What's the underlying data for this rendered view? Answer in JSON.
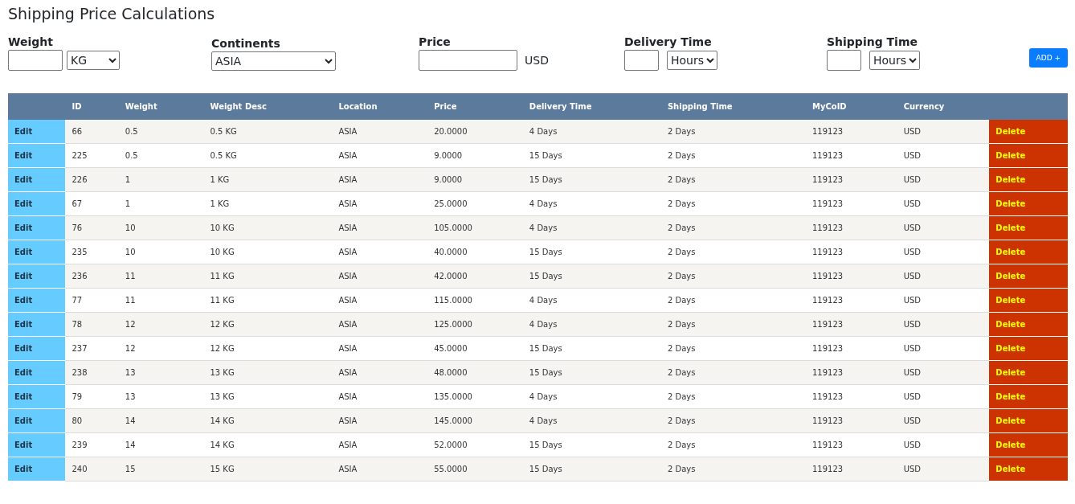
{
  "title": "Shipping Price Calculations",
  "form": {
    "fields": [
      {
        "kind": "weight",
        "label": "Weight",
        "select": "KG"
      },
      {
        "kind": "continent",
        "label": "Continents",
        "select": "ASIA"
      },
      {
        "kind": "price",
        "label": "Price",
        "suffix": "USD"
      },
      {
        "kind": "time",
        "label": "Delivery Time",
        "select": "Hours"
      },
      {
        "kind": "time",
        "label": "Shipping Time",
        "select": "Hours"
      }
    ],
    "add_button": "ADD +"
  },
  "table": {
    "columns": [
      "ID",
      "Weight",
      "Weight Desc",
      "Location",
      "Price",
      "Delivery Time",
      "Shipping Time",
      "MyCoID",
      "Currency"
    ],
    "rows": [
      {
        "edit": "Edit",
        "cells": [
          "66",
          "0.5",
          "0.5 KG",
          "ASIA",
          "20.0000",
          "4 Days",
          "2 Days",
          "119123",
          "USD"
        ],
        "delete": "Delete"
      },
      {
        "edit": "Edit",
        "cells": [
          "225",
          "0.5",
          "0.5 KG",
          "ASIA",
          "9.0000",
          "15 Days",
          "2 Days",
          "119123",
          "USD"
        ],
        "delete": "Delete"
      },
      {
        "edit": "Edit",
        "cells": [
          "226",
          "1",
          "1 KG",
          "ASIA",
          "9.0000",
          "15 Days",
          "2 Days",
          "119123",
          "USD"
        ],
        "delete": "Delete"
      },
      {
        "edit": "Edit",
        "cells": [
          "67",
          "1",
          "1 KG",
          "ASIA",
          "25.0000",
          "4 Days",
          "2 Days",
          "119123",
          "USD"
        ],
        "delete": "Delete"
      },
      {
        "edit": "Edit",
        "cells": [
          "76",
          "10",
          "10 KG",
          "ASIA",
          "105.0000",
          "4 Days",
          "2 Days",
          "119123",
          "USD"
        ],
        "delete": "Delete"
      },
      {
        "edit": "Edit",
        "cells": [
          "235",
          "10",
          "10 KG",
          "ASIA",
          "40.0000",
          "15 Days",
          "2 Days",
          "119123",
          "USD"
        ],
        "delete": "Delete"
      },
      {
        "edit": "Edit",
        "cells": [
          "236",
          "11",
          "11 KG",
          "ASIA",
          "42.0000",
          "15 Days",
          "2 Days",
          "119123",
          "USD"
        ],
        "delete": "Delete"
      },
      {
        "edit": "Edit",
        "cells": [
          "77",
          "11",
          "11 KG",
          "ASIA",
          "115.0000",
          "4 Days",
          "2 Days",
          "119123",
          "USD"
        ],
        "delete": "Delete"
      },
      {
        "edit": "Edit",
        "cells": [
          "78",
          "12",
          "12 KG",
          "ASIA",
          "125.0000",
          "4 Days",
          "2 Days",
          "119123",
          "USD"
        ],
        "delete": "Delete"
      },
      {
        "edit": "Edit",
        "cells": [
          "237",
          "12",
          "12 KG",
          "ASIA",
          "45.0000",
          "15 Days",
          "2 Days",
          "119123",
          "USD"
        ],
        "delete": "Delete"
      },
      {
        "edit": "Edit",
        "cells": [
          "238",
          "13",
          "13 KG",
          "ASIA",
          "48.0000",
          "15 Days",
          "2 Days",
          "119123",
          "USD"
        ],
        "delete": "Delete"
      },
      {
        "edit": "Edit",
        "cells": [
          "79",
          "13",
          "13 KG",
          "ASIA",
          "135.0000",
          "4 Days",
          "2 Days",
          "119123",
          "USD"
        ],
        "delete": "Delete"
      },
      {
        "edit": "Edit",
        "cells": [
          "80",
          "14",
          "14 KG",
          "ASIA",
          "145.0000",
          "4 Days",
          "2 Days",
          "119123",
          "USD"
        ],
        "delete": "Delete"
      },
      {
        "edit": "Edit",
        "cells": [
          "239",
          "14",
          "14 KG",
          "ASIA",
          "52.0000",
          "15 Days",
          "2 Days",
          "119123",
          "USD"
        ],
        "delete": "Delete"
      },
      {
        "edit": "Edit",
        "cells": [
          "240",
          "15",
          "15 KG",
          "ASIA",
          "55.0000",
          "15 Days",
          "2 Days",
          "119123",
          "USD"
        ],
        "delete": "Delete"
      }
    ]
  }
}
